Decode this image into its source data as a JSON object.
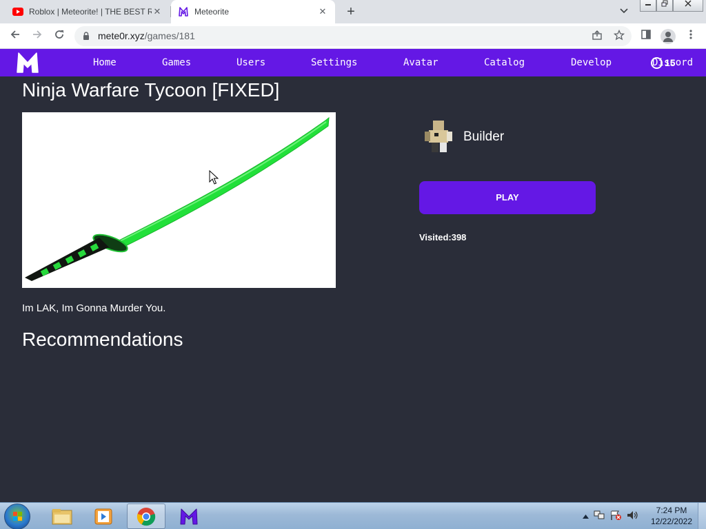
{
  "browser": {
    "tabs": [
      {
        "title": "Roblox | Meteorite! | THE BEST R",
        "favicon": "youtube-icon",
        "active": false
      },
      {
        "title": "Meteorite",
        "favicon": "meteorite-icon",
        "active": true
      }
    ],
    "close_glyph": "✕",
    "newtab_glyph": "+",
    "url_host": "mete0r.xyz",
    "url_path": "/games/181"
  },
  "nav": {
    "links": [
      "Home",
      "Games",
      "Users",
      "Settings",
      "Avatar",
      "Catalog",
      "Develop",
      "Discord"
    ],
    "balance": "15",
    "logo_letter": "M"
  },
  "game": {
    "title": "Ninja Warfare Tycoon [FIXED]",
    "creator": "Builder",
    "play_label": "PLAY",
    "visits": "Visited:398",
    "description": "Im LAK, Im Gonna Murder You."
  },
  "recommendations": {
    "title": "Recommendations"
  },
  "taskbar": {
    "time": "7:24 PM",
    "date": "12/22/2022"
  },
  "colors": {
    "accent": "#6418e5",
    "page_bg": "#2a2d39",
    "blade": "#22e03a"
  }
}
